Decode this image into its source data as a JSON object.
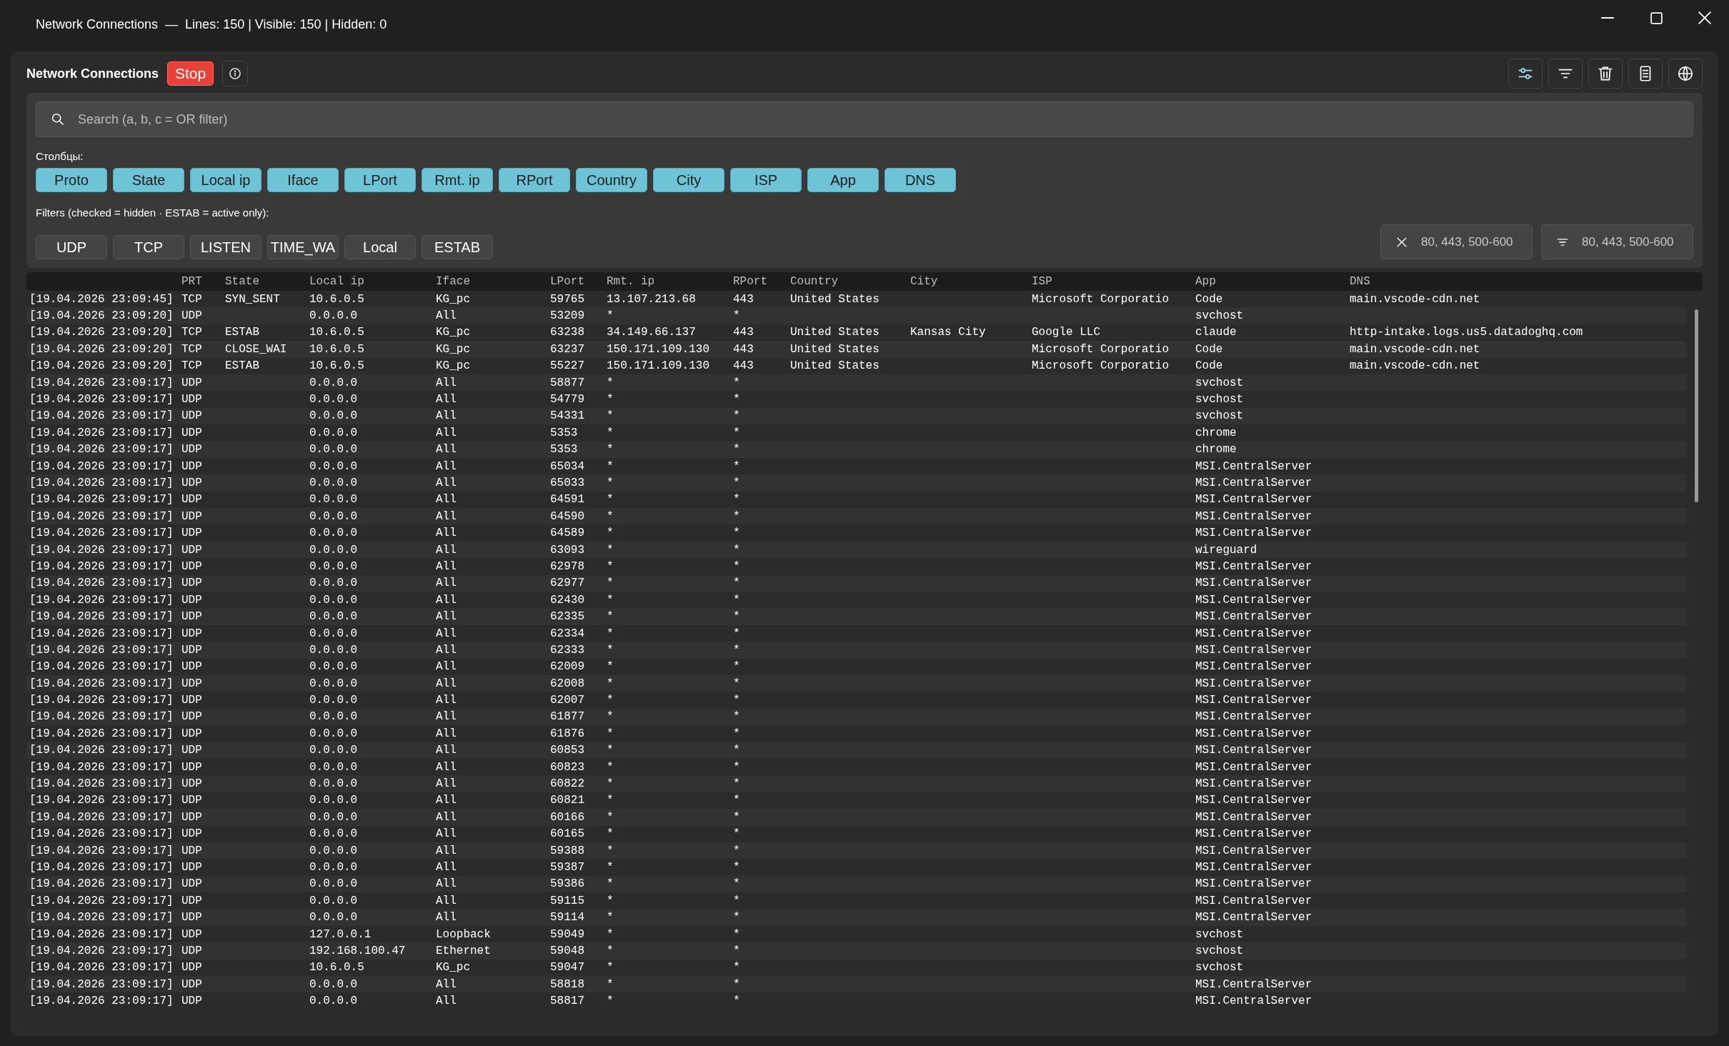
{
  "window": {
    "title": "Network Connections",
    "separator": "—",
    "stats": "Lines: 150 | Visible: 150 | Hidden: 0"
  },
  "header": {
    "title": "Network Connections",
    "stop_button": "Stop"
  },
  "search": {
    "placeholder": "Search (a, b, c = OR filter)"
  },
  "columns_label": "Столбцы:",
  "columns": [
    {
      "label": "Proto",
      "on": true
    },
    {
      "label": "State",
      "on": true
    },
    {
      "label": "Local ip",
      "on": true
    },
    {
      "label": "Iface",
      "on": true
    },
    {
      "label": "LPort",
      "on": true
    },
    {
      "label": "Rmt. ip",
      "on": true
    },
    {
      "label": "RPort",
      "on": true
    },
    {
      "label": "Country",
      "on": true
    },
    {
      "label": "City",
      "on": true
    },
    {
      "label": "ISP",
      "on": true
    },
    {
      "label": "App",
      "on": true
    },
    {
      "label": "DNS",
      "on": true
    }
  ],
  "filters_label": "Filters (checked = hidden · ESTAB = active only):",
  "filters": [
    {
      "label": "UDP",
      "checked": false
    },
    {
      "label": "TCP",
      "checked": false
    },
    {
      "label": "LISTEN",
      "checked": false
    },
    {
      "label": "TIME_WA",
      "checked": false
    },
    {
      "label": "Local",
      "checked": false
    },
    {
      "label": "ESTAB",
      "checked": false
    }
  ],
  "port_fields": [
    {
      "kind": "exclude",
      "placeholder": "80, 443, 500-600"
    },
    {
      "kind": "include",
      "placeholder": "80, 443, 500-600"
    }
  ],
  "table": {
    "columns": [
      "",
      "PRT",
      "State",
      "Local ip",
      "Iface",
      "LPort",
      "Rmt. ip",
      "RPort",
      "Country",
      "City",
      "ISP",
      "App",
      "DNS"
    ],
    "rows": [
      [
        "[19.04.2026 23:09:45]",
        "TCP",
        "SYN_SENT",
        "10.6.0.5",
        "KG_pc",
        "59765",
        "13.107.213.68",
        "443",
        "United States",
        "",
        "Microsoft Corporatio",
        "Code",
        "main.vscode-cdn.net"
      ],
      [
        "[19.04.2026 23:09:20]",
        "UDP",
        "",
        "0.0.0.0",
        "All",
        "53209",
        "*",
        "*",
        "",
        "",
        "",
        "svchost",
        ""
      ],
      [
        "[19.04.2026 23:09:20]",
        "TCP",
        "ESTAB",
        "10.6.0.5",
        "KG_pc",
        "63238",
        "34.149.66.137",
        "443",
        "United States",
        "Kansas City",
        "Google LLC",
        "claude",
        "http-intake.logs.us5.datadoghq.com"
      ],
      [
        "[19.04.2026 23:09:20]",
        "TCP",
        "CLOSE_WAI",
        "10.6.0.5",
        "KG_pc",
        "63237",
        "150.171.109.130",
        "443",
        "United States",
        "",
        "Microsoft Corporatio",
        "Code",
        "main.vscode-cdn.net"
      ],
      [
        "[19.04.2026 23:09:20]",
        "TCP",
        "ESTAB",
        "10.6.0.5",
        "KG_pc",
        "55227",
        "150.171.109.130",
        "443",
        "United States",
        "",
        "Microsoft Corporatio",
        "Code",
        "main.vscode-cdn.net"
      ],
      [
        "[19.04.2026 23:09:17]",
        "UDP",
        "",
        "0.0.0.0",
        "All",
        "58877",
        "*",
        "*",
        "",
        "",
        "",
        "svchost",
        ""
      ],
      [
        "[19.04.2026 23:09:17]",
        "UDP",
        "",
        "0.0.0.0",
        "All",
        "54779",
        "*",
        "*",
        "",
        "",
        "",
        "svchost",
        ""
      ],
      [
        "[19.04.2026 23:09:17]",
        "UDP",
        "",
        "0.0.0.0",
        "All",
        "54331",
        "*",
        "*",
        "",
        "",
        "",
        "svchost",
        ""
      ],
      [
        "[19.04.2026 23:09:17]",
        "UDP",
        "",
        "0.0.0.0",
        "All",
        "5353",
        "*",
        "*",
        "",
        "",
        "",
        "chrome",
        ""
      ],
      [
        "[19.04.2026 23:09:17]",
        "UDP",
        "",
        "0.0.0.0",
        "All",
        "5353",
        "*",
        "*",
        "",
        "",
        "",
        "chrome",
        ""
      ],
      [
        "[19.04.2026 23:09:17]",
        "UDP",
        "",
        "0.0.0.0",
        "All",
        "65034",
        "*",
        "*",
        "",
        "",
        "",
        "MSI.CentralServer",
        ""
      ],
      [
        "[19.04.2026 23:09:17]",
        "UDP",
        "",
        "0.0.0.0",
        "All",
        "65033",
        "*",
        "*",
        "",
        "",
        "",
        "MSI.CentralServer",
        ""
      ],
      [
        "[19.04.2026 23:09:17]",
        "UDP",
        "",
        "0.0.0.0",
        "All",
        "64591",
        "*",
        "*",
        "",
        "",
        "",
        "MSI.CentralServer",
        ""
      ],
      [
        "[19.04.2026 23:09:17]",
        "UDP",
        "",
        "0.0.0.0",
        "All",
        "64590",
        "*",
        "*",
        "",
        "",
        "",
        "MSI.CentralServer",
        ""
      ],
      [
        "[19.04.2026 23:09:17]",
        "UDP",
        "",
        "0.0.0.0",
        "All",
        "64589",
        "*",
        "*",
        "",
        "",
        "",
        "MSI.CentralServer",
        ""
      ],
      [
        "[19.04.2026 23:09:17]",
        "UDP",
        "",
        "0.0.0.0",
        "All",
        "63093",
        "*",
        "*",
        "",
        "",
        "",
        "wireguard",
        ""
      ],
      [
        "[19.04.2026 23:09:17]",
        "UDP",
        "",
        "0.0.0.0",
        "All",
        "62978",
        "*",
        "*",
        "",
        "",
        "",
        "MSI.CentralServer",
        ""
      ],
      [
        "[19.04.2026 23:09:17]",
        "UDP",
        "",
        "0.0.0.0",
        "All",
        "62977",
        "*",
        "*",
        "",
        "",
        "",
        "MSI.CentralServer",
        ""
      ],
      [
        "[19.04.2026 23:09:17]",
        "UDP",
        "",
        "0.0.0.0",
        "All",
        "62430",
        "*",
        "*",
        "",
        "",
        "",
        "MSI.CentralServer",
        ""
      ],
      [
        "[19.04.2026 23:09:17]",
        "UDP",
        "",
        "0.0.0.0",
        "All",
        "62335",
        "*",
        "*",
        "",
        "",
        "",
        "MSI.CentralServer",
        ""
      ],
      [
        "[19.04.2026 23:09:17]",
        "UDP",
        "",
        "0.0.0.0",
        "All",
        "62334",
        "*",
        "*",
        "",
        "",
        "",
        "MSI.CentralServer",
        ""
      ],
      [
        "[19.04.2026 23:09:17]",
        "UDP",
        "",
        "0.0.0.0",
        "All",
        "62333",
        "*",
        "*",
        "",
        "",
        "",
        "MSI.CentralServer",
        ""
      ],
      [
        "[19.04.2026 23:09:17]",
        "UDP",
        "",
        "0.0.0.0",
        "All",
        "62009",
        "*",
        "*",
        "",
        "",
        "",
        "MSI.CentralServer",
        ""
      ],
      [
        "[19.04.2026 23:09:17]",
        "UDP",
        "",
        "0.0.0.0",
        "All",
        "62008",
        "*",
        "*",
        "",
        "",
        "",
        "MSI.CentralServer",
        ""
      ],
      [
        "[19.04.2026 23:09:17]",
        "UDP",
        "",
        "0.0.0.0",
        "All",
        "62007",
        "*",
        "*",
        "",
        "",
        "",
        "MSI.CentralServer",
        ""
      ],
      [
        "[19.04.2026 23:09:17]",
        "UDP",
        "",
        "0.0.0.0",
        "All",
        "61877",
        "*",
        "*",
        "",
        "",
        "",
        "MSI.CentralServer",
        ""
      ],
      [
        "[19.04.2026 23:09:17]",
        "UDP",
        "",
        "0.0.0.0",
        "All",
        "61876",
        "*",
        "*",
        "",
        "",
        "",
        "MSI.CentralServer",
        ""
      ],
      [
        "[19.04.2026 23:09:17]",
        "UDP",
        "",
        "0.0.0.0",
        "All",
        "60853",
        "*",
        "*",
        "",
        "",
        "",
        "MSI.CentralServer",
        ""
      ],
      [
        "[19.04.2026 23:09:17]",
        "UDP",
        "",
        "0.0.0.0",
        "All",
        "60823",
        "*",
        "*",
        "",
        "",
        "",
        "MSI.CentralServer",
        ""
      ],
      [
        "[19.04.2026 23:09:17]",
        "UDP",
        "",
        "0.0.0.0",
        "All",
        "60822",
        "*",
        "*",
        "",
        "",
        "",
        "MSI.CentralServer",
        ""
      ],
      [
        "[19.04.2026 23:09:17]",
        "UDP",
        "",
        "0.0.0.0",
        "All",
        "60821",
        "*",
        "*",
        "",
        "",
        "",
        "MSI.CentralServer",
        ""
      ],
      [
        "[19.04.2026 23:09:17]",
        "UDP",
        "",
        "0.0.0.0",
        "All",
        "60166",
        "*",
        "*",
        "",
        "",
        "",
        "MSI.CentralServer",
        ""
      ],
      [
        "[19.04.2026 23:09:17]",
        "UDP",
        "",
        "0.0.0.0",
        "All",
        "60165",
        "*",
        "*",
        "",
        "",
        "",
        "MSI.CentralServer",
        ""
      ],
      [
        "[19.04.2026 23:09:17]",
        "UDP",
        "",
        "0.0.0.0",
        "All",
        "59388",
        "*",
        "*",
        "",
        "",
        "",
        "MSI.CentralServer",
        ""
      ],
      [
        "[19.04.2026 23:09:17]",
        "UDP",
        "",
        "0.0.0.0",
        "All",
        "59387",
        "*",
        "*",
        "",
        "",
        "",
        "MSI.CentralServer",
        ""
      ],
      [
        "[19.04.2026 23:09:17]",
        "UDP",
        "",
        "0.0.0.0",
        "All",
        "59386",
        "*",
        "*",
        "",
        "",
        "",
        "MSI.CentralServer",
        ""
      ],
      [
        "[19.04.2026 23:09:17]",
        "UDP",
        "",
        "0.0.0.0",
        "All",
        "59115",
        "*",
        "*",
        "",
        "",
        "",
        "MSI.CentralServer",
        ""
      ],
      [
        "[19.04.2026 23:09:17]",
        "UDP",
        "",
        "0.0.0.0",
        "All",
        "59114",
        "*",
        "*",
        "",
        "",
        "",
        "MSI.CentralServer",
        ""
      ],
      [
        "[19.04.2026 23:09:17]",
        "UDP",
        "",
        "127.0.0.1",
        "Loopback",
        "59049",
        "*",
        "*",
        "",
        "",
        "",
        "svchost",
        ""
      ],
      [
        "[19.04.2026 23:09:17]",
        "UDP",
        "",
        "192.168.100.47",
        "Ethernet",
        "59048",
        "*",
        "*",
        "",
        "",
        "",
        "svchost",
        ""
      ],
      [
        "[19.04.2026 23:09:17]",
        "UDP",
        "",
        "10.6.0.5",
        "KG_pc",
        "59047",
        "*",
        "*",
        "",
        "",
        "",
        "svchost",
        ""
      ],
      [
        "[19.04.2026 23:09:17]",
        "UDP",
        "",
        "0.0.0.0",
        "All",
        "58818",
        "*",
        "*",
        "",
        "",
        "",
        "MSI.CentralServer",
        ""
      ],
      [
        "[19.04.2026 23:09:17]",
        "UDP",
        "",
        "0.0.0.0",
        "All",
        "58817",
        "*",
        "*",
        "",
        "",
        "",
        "MSI.CentralServer",
        ""
      ]
    ]
  }
}
